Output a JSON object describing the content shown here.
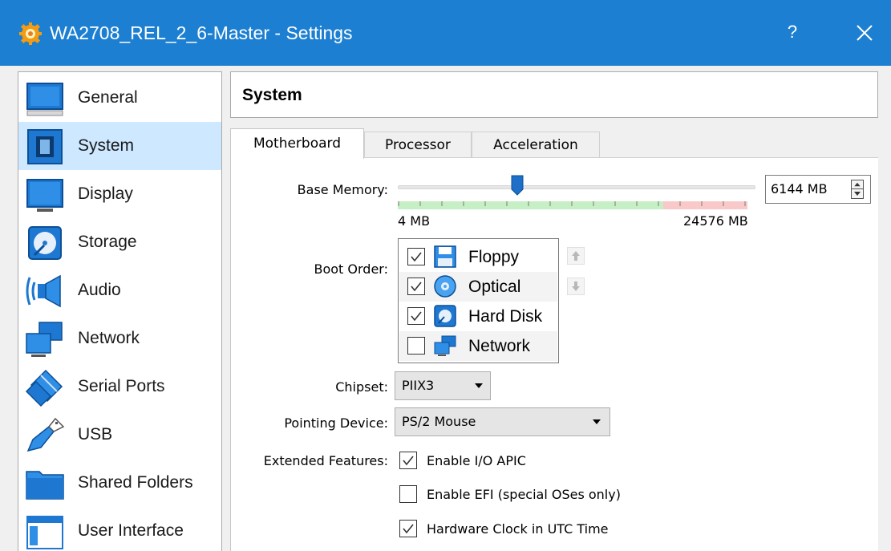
{
  "window": {
    "title": "WA2708_REL_2_6-Master - Settings",
    "help_label": "?",
    "titlebar_color": "#1c7fd1"
  },
  "sidebar": {
    "selected": "System",
    "items": [
      {
        "label": "General",
        "icon": "general-icon"
      },
      {
        "label": "System",
        "icon": "system-icon"
      },
      {
        "label": "Display",
        "icon": "display-icon"
      },
      {
        "label": "Storage",
        "icon": "storage-icon"
      },
      {
        "label": "Audio",
        "icon": "audio-icon"
      },
      {
        "label": "Network",
        "icon": "network-icon"
      },
      {
        "label": "Serial Ports",
        "icon": "serial-ports-icon"
      },
      {
        "label": "USB",
        "icon": "usb-icon"
      },
      {
        "label": "Shared Folders",
        "icon": "shared-folders-icon"
      },
      {
        "label": "User Interface",
        "icon": "user-interface-icon"
      }
    ]
  },
  "page": {
    "title": "System"
  },
  "tabs": [
    {
      "label": "Motherboard",
      "active": true
    },
    {
      "label": "Processor",
      "active": false
    },
    {
      "label": "Acceleration",
      "active": false
    }
  ],
  "motherboard": {
    "base_memory": {
      "label": "Base Memory:",
      "min_label": "4 MB",
      "max_label": "24576 MB",
      "value": 6144,
      "min": 4,
      "max": 24576,
      "value_text": "6144 MB"
    },
    "boot_order": {
      "label": "Boot Order:",
      "items": [
        {
          "label": "Floppy",
          "checked": true,
          "icon": "floppy-icon"
        },
        {
          "label": "Optical",
          "checked": true,
          "icon": "optical-icon"
        },
        {
          "label": "Hard Disk",
          "checked": true,
          "icon": "hard-disk-icon"
        },
        {
          "label": "Network",
          "checked": false,
          "icon": "network-icon"
        }
      ]
    },
    "chipset": {
      "label": "Chipset:",
      "value": "PIIX3"
    },
    "pointing_device": {
      "label": "Pointing Device:",
      "value": "PS/2 Mouse"
    },
    "extended_features": {
      "label": "Extended Features:",
      "options": [
        {
          "label": "Enable I/O APIC",
          "checked": true
        },
        {
          "label": "Enable EFI (special OSes only)",
          "checked": false
        },
        {
          "label": "Hardware Clock in UTC Time",
          "checked": true
        }
      ]
    }
  }
}
